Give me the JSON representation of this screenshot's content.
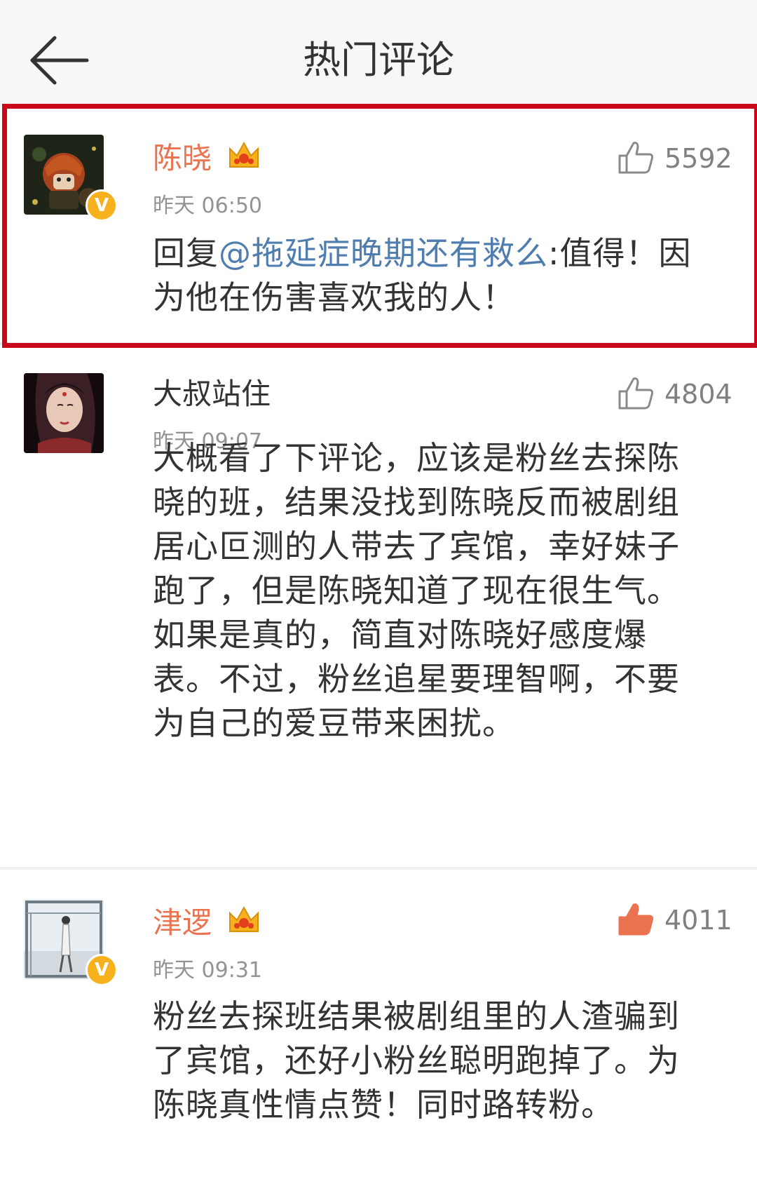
{
  "header": {
    "title": "热门评论"
  },
  "comments": [
    {
      "username": "陈晓",
      "vip": true,
      "verified": true,
      "time": "昨天 06:50",
      "likes": "5592",
      "liked": false,
      "reply_prefix": "回复",
      "mention": "@拖延症晚期还有救么",
      "text": ":值得！因为他在伤害喜欢我的人！"
    },
    {
      "username": "大叔站住",
      "vip": false,
      "verified": false,
      "time": "昨天 09:07",
      "likes": "4804",
      "liked": false,
      "text": "大概看了下评论，应该是粉丝去探陈晓的班，结果没找到陈晓反而被剧组居心叵测的人带去了宾馆，幸好妹子跑了，但是陈晓知道了现在很生气。如果是真的，简直对陈晓好感度爆表。不过，粉丝追星要理智啊，不要为自己的爱豆带来困扰。"
    },
    {
      "username": "津逻",
      "vip": true,
      "verified": true,
      "time": "昨天 09:31",
      "likes": "4011",
      "liked": true,
      "text": "粉丝去探班结果被剧组里的人渣骗到了宾馆，还好小粉丝聪明跑掉了。为陈晓真性情点赞！同时路转粉。"
    }
  ],
  "colors": {
    "vip_name": "#eb7350",
    "mention": "#507daf",
    "like_active": "#eb7350",
    "highlight_border": "#c8091a",
    "verified_badge": "#f6b11c"
  },
  "icons": {
    "back": "back-arrow-icon",
    "like": "thumbs-up-icon",
    "vip": "crown-icon",
    "verified": "verified-v-icon"
  }
}
